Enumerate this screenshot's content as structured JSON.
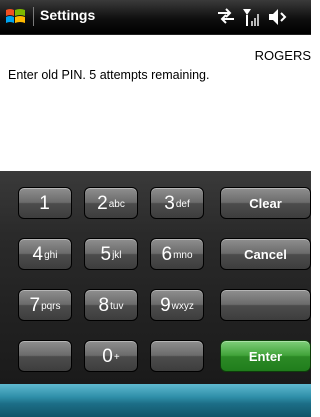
{
  "titlebar": {
    "title": "Settings",
    "start_icon": "windows-flag-icon",
    "status_icons": [
      "connectivity-arrows-icon",
      "signal-strength-icon",
      "volume-icon"
    ]
  },
  "content": {
    "operator": "ROGERS",
    "prompt": "Enter old PIN. 5 attempts remaining."
  },
  "keypad": {
    "keys": {
      "k1": {
        "digit": "1",
        "letters": ""
      },
      "k2": {
        "digit": "2",
        "letters": "abc"
      },
      "k3": {
        "digit": "3",
        "letters": "def"
      },
      "k4": {
        "digit": "4",
        "letters": "ghi"
      },
      "k5": {
        "digit": "5",
        "letters": "jkl"
      },
      "k6": {
        "digit": "6",
        "letters": "mno"
      },
      "k7": {
        "digit": "7",
        "letters": "pqrs"
      },
      "k8": {
        "digit": "8",
        "letters": "tuv"
      },
      "k9": {
        "digit": "9",
        "letters": "wxyz"
      },
      "k0": {
        "digit": "0",
        "letters": "+"
      }
    },
    "clear_label": "Clear",
    "cancel_label": "Cancel",
    "enter_label": "Enter"
  },
  "colors": {
    "titlebar": "#000000",
    "keypad_bg": "#2a2a2a",
    "enter_key": "#3a9a34",
    "bottombar": "#2e8ea8"
  }
}
